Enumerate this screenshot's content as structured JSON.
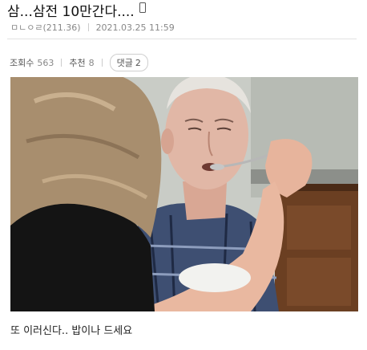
{
  "post": {
    "title": "삼...삼전 10만간다....",
    "author": "ㅁㄴㅇㄹ(211.36)",
    "date": "2021.03.25 11:59",
    "stats": {
      "views_label": "조회수",
      "views": "563",
      "recommend_label": "추천",
      "recommend": "8",
      "comments_label": "댓글",
      "comments": "2"
    },
    "body_text": "또 이러신다.. 밥이나 드세요"
  },
  "icons": {
    "mobile": "mobile-phone-icon"
  },
  "colors": {
    "meta_text": "#888888",
    "divider": "#e3e3e3"
  }
}
